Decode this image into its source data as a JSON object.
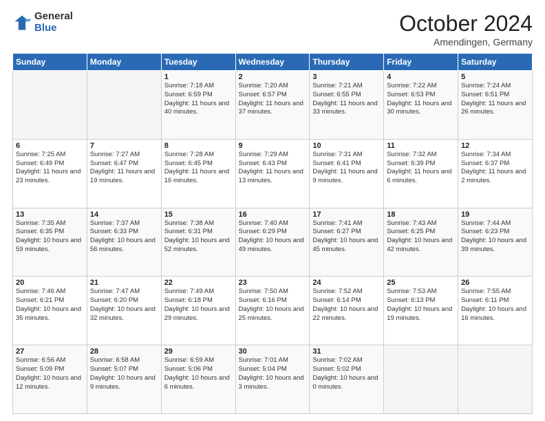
{
  "logo": {
    "general": "General",
    "blue": "Blue"
  },
  "header": {
    "month": "October 2024",
    "location": "Amendingen, Germany"
  },
  "weekdays": [
    "Sunday",
    "Monday",
    "Tuesday",
    "Wednesday",
    "Thursday",
    "Friday",
    "Saturday"
  ],
  "weeks": [
    [
      {
        "day": "",
        "info": ""
      },
      {
        "day": "",
        "info": ""
      },
      {
        "day": "1",
        "info": "Sunrise: 7:18 AM\nSunset: 6:59 PM\nDaylight: 11 hours and 40 minutes."
      },
      {
        "day": "2",
        "info": "Sunrise: 7:20 AM\nSunset: 6:57 PM\nDaylight: 11 hours and 37 minutes."
      },
      {
        "day": "3",
        "info": "Sunrise: 7:21 AM\nSunset: 6:55 PM\nDaylight: 11 hours and 33 minutes."
      },
      {
        "day": "4",
        "info": "Sunrise: 7:22 AM\nSunset: 6:53 PM\nDaylight: 11 hours and 30 minutes."
      },
      {
        "day": "5",
        "info": "Sunrise: 7:24 AM\nSunset: 6:51 PM\nDaylight: 11 hours and 26 minutes."
      }
    ],
    [
      {
        "day": "6",
        "info": "Sunrise: 7:25 AM\nSunset: 6:49 PM\nDaylight: 11 hours and 23 minutes."
      },
      {
        "day": "7",
        "info": "Sunrise: 7:27 AM\nSunset: 6:47 PM\nDaylight: 11 hours and 19 minutes."
      },
      {
        "day": "8",
        "info": "Sunrise: 7:28 AM\nSunset: 6:45 PM\nDaylight: 11 hours and 16 minutes."
      },
      {
        "day": "9",
        "info": "Sunrise: 7:29 AM\nSunset: 6:43 PM\nDaylight: 11 hours and 13 minutes."
      },
      {
        "day": "10",
        "info": "Sunrise: 7:31 AM\nSunset: 6:41 PM\nDaylight: 11 hours and 9 minutes."
      },
      {
        "day": "11",
        "info": "Sunrise: 7:32 AM\nSunset: 6:39 PM\nDaylight: 11 hours and 6 minutes."
      },
      {
        "day": "12",
        "info": "Sunrise: 7:34 AM\nSunset: 6:37 PM\nDaylight: 11 hours and 2 minutes."
      }
    ],
    [
      {
        "day": "13",
        "info": "Sunrise: 7:35 AM\nSunset: 6:35 PM\nDaylight: 10 hours and 59 minutes."
      },
      {
        "day": "14",
        "info": "Sunrise: 7:37 AM\nSunset: 6:33 PM\nDaylight: 10 hours and 56 minutes."
      },
      {
        "day": "15",
        "info": "Sunrise: 7:38 AM\nSunset: 6:31 PM\nDaylight: 10 hours and 52 minutes."
      },
      {
        "day": "16",
        "info": "Sunrise: 7:40 AM\nSunset: 6:29 PM\nDaylight: 10 hours and 49 minutes."
      },
      {
        "day": "17",
        "info": "Sunrise: 7:41 AM\nSunset: 6:27 PM\nDaylight: 10 hours and 45 minutes."
      },
      {
        "day": "18",
        "info": "Sunrise: 7:43 AM\nSunset: 6:25 PM\nDaylight: 10 hours and 42 minutes."
      },
      {
        "day": "19",
        "info": "Sunrise: 7:44 AM\nSunset: 6:23 PM\nDaylight: 10 hours and 39 minutes."
      }
    ],
    [
      {
        "day": "20",
        "info": "Sunrise: 7:46 AM\nSunset: 6:21 PM\nDaylight: 10 hours and 35 minutes."
      },
      {
        "day": "21",
        "info": "Sunrise: 7:47 AM\nSunset: 6:20 PM\nDaylight: 10 hours and 32 minutes."
      },
      {
        "day": "22",
        "info": "Sunrise: 7:49 AM\nSunset: 6:18 PM\nDaylight: 10 hours and 29 minutes."
      },
      {
        "day": "23",
        "info": "Sunrise: 7:50 AM\nSunset: 6:16 PM\nDaylight: 10 hours and 25 minutes."
      },
      {
        "day": "24",
        "info": "Sunrise: 7:52 AM\nSunset: 6:14 PM\nDaylight: 10 hours and 22 minutes."
      },
      {
        "day": "25",
        "info": "Sunrise: 7:53 AM\nSunset: 6:13 PM\nDaylight: 10 hours and 19 minutes."
      },
      {
        "day": "26",
        "info": "Sunrise: 7:55 AM\nSunset: 6:11 PM\nDaylight: 10 hours and 16 minutes."
      }
    ],
    [
      {
        "day": "27",
        "info": "Sunrise: 6:56 AM\nSunset: 5:09 PM\nDaylight: 10 hours and 12 minutes."
      },
      {
        "day": "28",
        "info": "Sunrise: 6:58 AM\nSunset: 5:07 PM\nDaylight: 10 hours and 9 minutes."
      },
      {
        "day": "29",
        "info": "Sunrise: 6:59 AM\nSunset: 5:06 PM\nDaylight: 10 hours and 6 minutes."
      },
      {
        "day": "30",
        "info": "Sunrise: 7:01 AM\nSunset: 5:04 PM\nDaylight: 10 hours and 3 minutes."
      },
      {
        "day": "31",
        "info": "Sunrise: 7:02 AM\nSunset: 5:02 PM\nDaylight: 10 hours and 0 minutes."
      },
      {
        "day": "",
        "info": ""
      },
      {
        "day": "",
        "info": ""
      }
    ]
  ]
}
